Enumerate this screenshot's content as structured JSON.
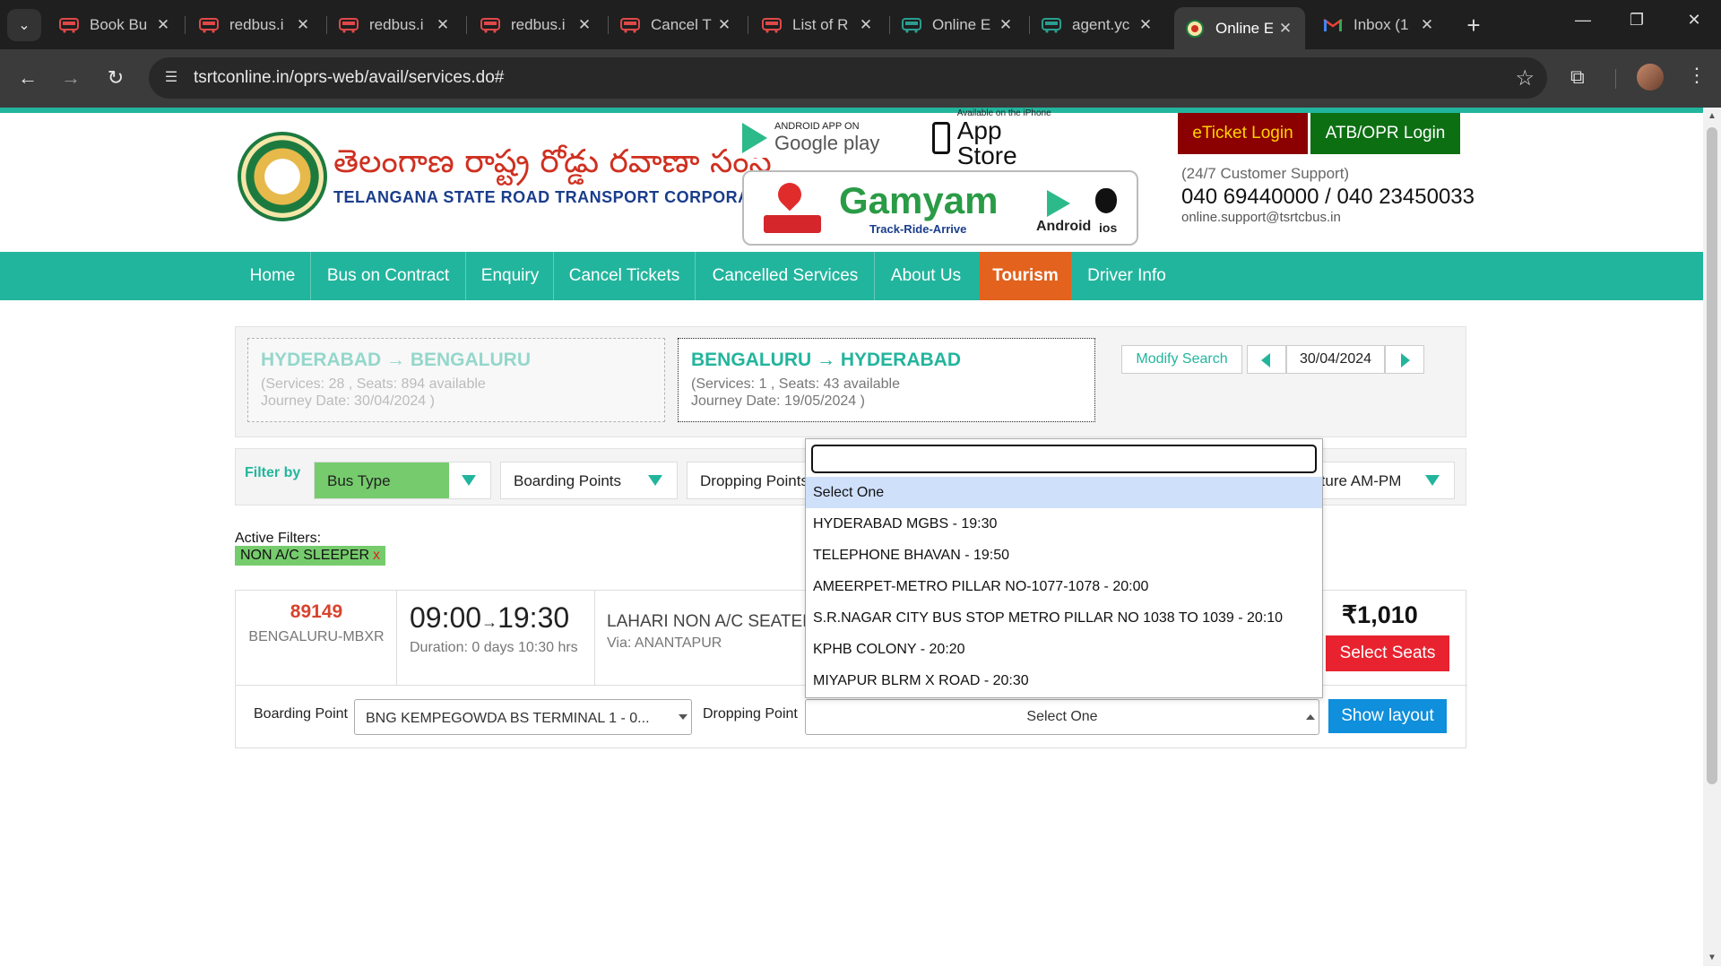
{
  "browser": {
    "tabs": [
      {
        "title": "Book Bu",
        "favicon": "bus-icon"
      },
      {
        "title": "redbus.i",
        "favicon": "bus-icon"
      },
      {
        "title": "redbus.i",
        "favicon": "bus-icon"
      },
      {
        "title": "redbus.i",
        "favicon": "bus-icon"
      },
      {
        "title": "Cancel T",
        "favicon": "bus-icon"
      },
      {
        "title": "List of R",
        "favicon": "bus-icon"
      },
      {
        "title": "Online E",
        "favicon": "bus-icon"
      },
      {
        "title": "agent.yc",
        "favicon": "bus-icon"
      },
      {
        "title": "Online E",
        "favicon": "tsrtc-logo-icon",
        "active": true
      },
      {
        "title": "Inbox (1",
        "favicon": "gmail-icon"
      }
    ],
    "url": "tsrtconline.in/oprs-web/avail/services.do#"
  },
  "header": {
    "brand_telugu": "తెలంగాణ రాష్ట్ర రోడ్డు రవాణా సంస్థ",
    "brand_english": "TELANGANA STATE ROAD TRANSPORT CORPORATION",
    "google_play_small": "ANDROID APP ON",
    "google_play_big": "Google play",
    "app_store_small": "Available on the iPhone",
    "app_store_big": "App Store",
    "gamyam_name": "Gamyam",
    "gamyam_tagline": "Track-Ride-Arrive",
    "gamyam_android": "Android",
    "gamyam_ios": "ios",
    "eticket_login": "eTicket Login",
    "atb_login": "ATB/OPR Login",
    "support_label": "(24/7 Customer Support)",
    "support_phones": "040 69440000 / 040 23450033",
    "support_email": "online.support@tsrtcbus.in"
  },
  "nav": {
    "items": [
      "Home",
      "Bus on Contract",
      "Enquiry",
      "Cancel Tickets",
      "Cancelled Services",
      "About Us",
      "Tourism",
      "Driver Info"
    ]
  },
  "search": {
    "onward": {
      "route": "HYDERABAD → BENGALURU",
      "services": "(Services: 28 , Seats: 894 available",
      "journey": "Journey Date: 30/04/2024 )"
    },
    "return": {
      "route": "BENGALURU → HYDERABAD",
      "services": "(Services: 1 , Seats: 43 available",
      "journey": "Journey Date: 19/05/2024 )"
    },
    "modify_label": "Modify Search",
    "date": "30/04/2024"
  },
  "filters": {
    "label": "Filter by",
    "bus_type": "Bus Type",
    "boarding_points": "Boarding Points",
    "dropping_points": "Dropping Points",
    "departure": "rture AM-PM",
    "active_label": "Active Filters:",
    "active_chip": "NON A/C SLEEPER",
    "chip_remove": "x"
  },
  "service": {
    "number": "89149",
    "code": "BENGALURU-MBXR",
    "depart": "09:00",
    "arrow": "→",
    "arrive": "19:30",
    "duration": "Duration: 0 days 10:30 hrs",
    "bus_type": "LAHARI NON A/C SEATER",
    "via": "Via: ANANTAPUR",
    "price": "₹1,010",
    "select_seats": "Select Seats",
    "boarding_label": "Boarding Point",
    "boarding_value": "BNG KEMPEGOWDA BS TERMINAL 1 - 0...",
    "dropping_label": "Dropping Point",
    "dropping_value": "Select One",
    "show_layout": "Show layout"
  },
  "dropdown": {
    "search_value": "",
    "options": [
      "Select One",
      "HYDERABAD MGBS - 19:30",
      "TELEPHONE BHAVAN - 19:50",
      "AMEERPET-METRO PILLAR NO-1077-1078 - 20:00",
      "S.R.NAGAR CITY BUS STOP METRO PILLAR NO 1038 TO 1039 - 20:10",
      "KPHB COLONY - 20:20",
      "MIYAPUR BLRM X ROAD - 20:30"
    ],
    "selected_index": 0
  }
}
